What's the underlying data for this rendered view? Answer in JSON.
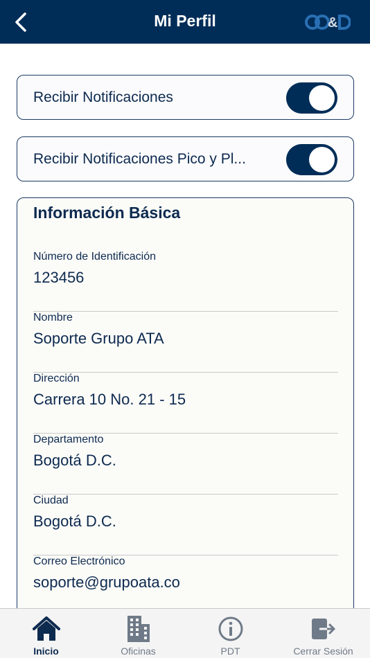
{
  "header": {
    "title": "Mi Perfil",
    "back_icon": "chevron-left-icon",
    "logo_text": "CC&D"
  },
  "toggles": [
    {
      "label": "Recibir Notificaciones",
      "on": true
    },
    {
      "label": "Recibir Notificaciones Pico y Pl...",
      "on": true
    }
  ],
  "info": {
    "title": "Información Básica",
    "fields": [
      {
        "label": "Número de Identificación",
        "value": "123456"
      },
      {
        "label": "Nombre",
        "value": "Soporte Grupo ATA"
      },
      {
        "label": "Dirección",
        "value": "Carrera 10 No. 21 - 15"
      },
      {
        "label": "Departamento",
        "value": "Bogotá D.C."
      },
      {
        "label": "Ciudad",
        "value": "Bogotá D.C."
      },
      {
        "label": "Correo Electrónico",
        "value": "soporte@grupoata.co"
      }
    ]
  },
  "tabs": [
    {
      "label": "Inicio",
      "icon": "home-icon",
      "active": true
    },
    {
      "label": "Oficinas",
      "icon": "building-icon",
      "active": false
    },
    {
      "label": "PDT",
      "icon": "info-icon",
      "active": false
    },
    {
      "label": "Cerrar Sesión",
      "icon": "logout-icon",
      "active": false
    }
  ],
  "colors": {
    "primary": "#002d58",
    "inactive_tab": "#6f7a88",
    "divider": "#c8c8c8"
  }
}
